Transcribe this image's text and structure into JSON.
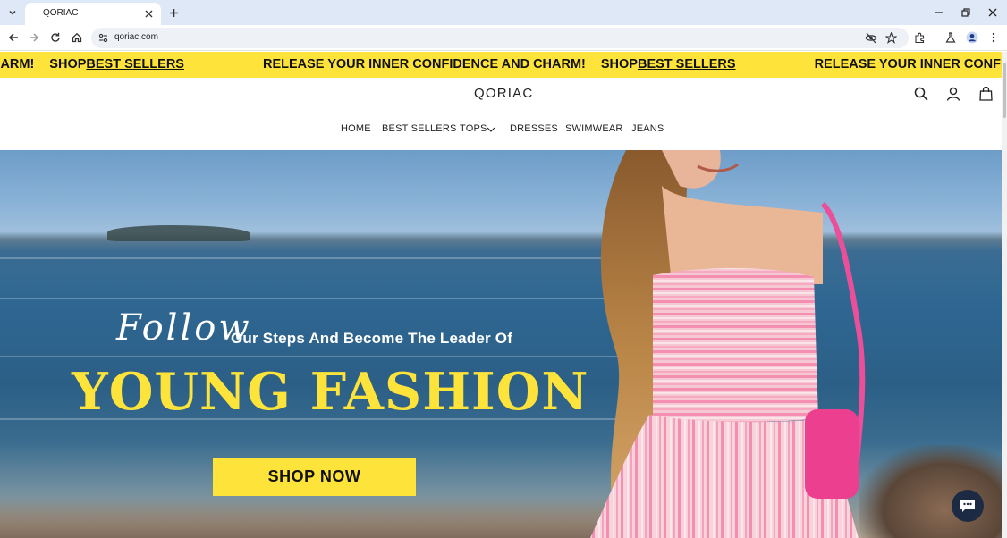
{
  "browser": {
    "tab_title": "QORIAC",
    "url": "qoriac.com",
    "icons": [
      "chevron-down-icon",
      "close-icon",
      "plus-icon",
      "minimize-icon",
      "restore-icon",
      "close-window-icon",
      "back-icon",
      "forward-icon",
      "reload-icon",
      "home-icon",
      "site-info-icon",
      "eye-off-icon",
      "star-icon",
      "extensions-icon",
      "labs-icon",
      "profile-icon",
      "menu-dots-icon"
    ]
  },
  "announcement": {
    "segment_a": "D CHARM!",
    "shop": "SHOP ",
    "best_sellers": "BEST SELLERS",
    "release": "RELEASE YOUR INNER CONFIDENCE AND CHARM!",
    "release_cut": "RELEASE YOUR INNER CONFIDENCE AN"
  },
  "header": {
    "logo": "QORIAC",
    "icons": [
      "search-icon",
      "account-icon",
      "cart-icon"
    ]
  },
  "nav": {
    "items": [
      {
        "label": "HOME"
      },
      {
        "label": "BEST SELLERS"
      },
      {
        "label": "TOPS"
      },
      {
        "label": "DRESSES"
      },
      {
        "label": "SWIMWEAR"
      },
      {
        "label": "JEANS"
      }
    ]
  },
  "hero": {
    "script_word": "Follow",
    "tagline": "Our Steps And Become The Leader Of",
    "headline": "YOUNG FASHION",
    "cta": "SHOP NOW"
  },
  "colors": {
    "accent_yellow": "#fde33a",
    "chat_bg": "#1d2a43"
  }
}
